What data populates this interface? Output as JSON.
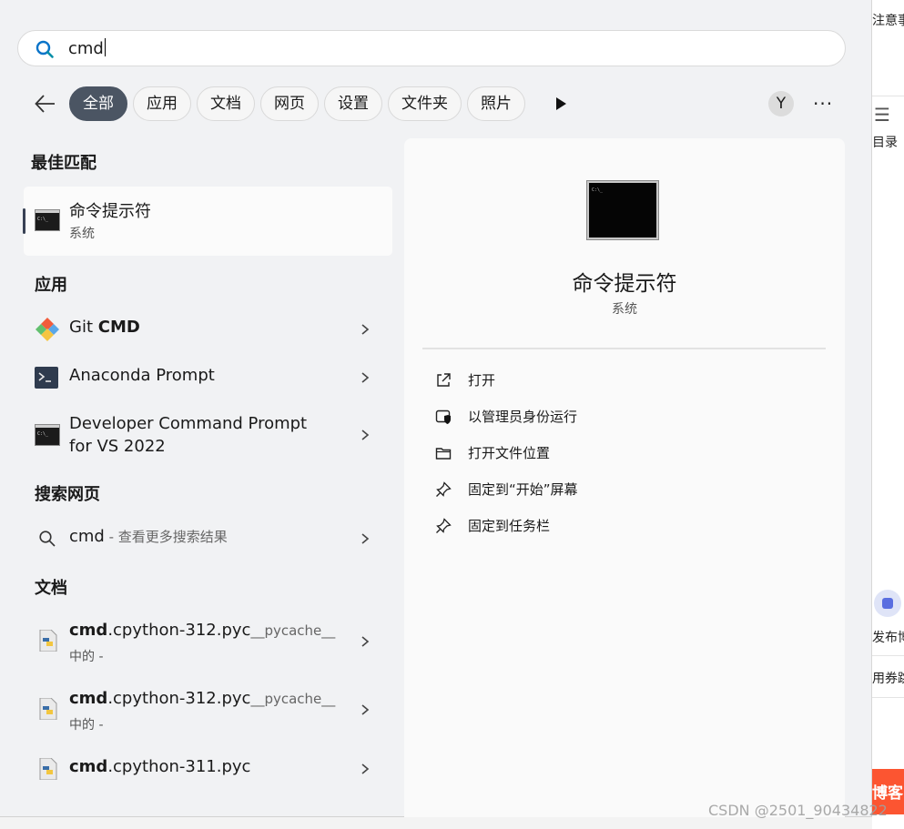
{
  "background_page": {
    "top_text": "注意事",
    "toc_label": "目录",
    "publish_label": "发布博",
    "coupon_label": "用券跳",
    "red_button_label": "博客",
    "watermark": "CSDN @2501_90434822"
  },
  "search": {
    "value": "cmd"
  },
  "filters": [
    "全部",
    "应用",
    "文档",
    "网页",
    "设置",
    "文件夹",
    "照片"
  ],
  "avatar_letter": "Y",
  "sections": {
    "best_match": "最佳匹配",
    "apps": "应用",
    "web": "搜索网页",
    "documents": "文档"
  },
  "best_match": {
    "title": "命令提示符",
    "subtitle": "系统"
  },
  "apps": [
    {
      "name_plain": "Git ",
      "name_bold": "CMD",
      "icon": "git-icon"
    },
    {
      "name": "Anaconda Prompt",
      "icon": "terminal-icon"
    },
    {
      "line1": "Developer Command Prompt",
      "line2": "for VS 2022",
      "icon": "console-icon"
    }
  ],
  "web": {
    "query": "cmd",
    "suffix": " - 查看更多搜索结果"
  },
  "documents": [
    {
      "bold": "cmd",
      "rest": ".cpython-312.pyc",
      "tag": "__pycache__",
      "sub": "中的 -"
    },
    {
      "bold": "cmd",
      "rest": ".cpython-312.pyc",
      "tag": "__pycache__",
      "sub": "中的 -"
    },
    {
      "bold": "cmd",
      "rest": ".cpython-311.pyc"
    }
  ],
  "detail": {
    "title": "命令提示符",
    "subtitle": "系统",
    "actions": [
      "打开",
      "以管理员身份运行",
      "打开文件位置",
      "固定到“开始”屏幕",
      "固定到任务栏"
    ]
  },
  "colors": {
    "accent": "#4b5563",
    "panel": "#f1f2f4",
    "search_icon": "#0a74c9",
    "red": "#fc5531"
  }
}
